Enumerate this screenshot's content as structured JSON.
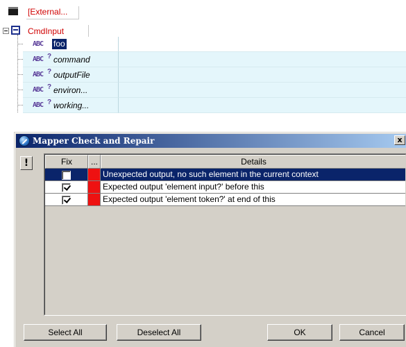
{
  "tree": {
    "external_label": "[External...",
    "cmdinput_label": "CmdInput",
    "attributes": [
      {
        "icon": "ABC",
        "optional": false,
        "name": "foo"
      },
      {
        "icon": "ABC",
        "optional": true,
        "name": "command"
      },
      {
        "icon": "ABC",
        "optional": true,
        "name": "outputFile"
      },
      {
        "icon": "ABC",
        "optional": true,
        "name": "environ..."
      },
      {
        "icon": "ABC",
        "optional": true,
        "name": "working..."
      }
    ]
  },
  "dialog": {
    "title": "Mapper Check and Repair",
    "close_glyph": "x",
    "side_button": "!",
    "columns": {
      "fix": "Fix",
      "dots": "...",
      "details": "Details"
    },
    "rows": [
      {
        "checked": false,
        "severity_color": "#ee1111",
        "details": "Unexpected output, no such element in the current context",
        "selected": true
      },
      {
        "checked": true,
        "severity_color": "#ee1111",
        "details": "Expected output 'element input?' before this",
        "selected": false
      },
      {
        "checked": true,
        "severity_color": "#ee1111",
        "details": "Expected output 'element token?' at end of this",
        "selected": false
      }
    ],
    "buttons": {
      "select_all": "Select All",
      "deselect_all": "Deselect All",
      "ok": "OK",
      "cancel": "Cancel"
    }
  },
  "colors": {
    "selection": "#0a246a",
    "error_marker": "#ee1111",
    "tree_label": "#d00000",
    "attr_row_bg": "#e4f6fb"
  }
}
